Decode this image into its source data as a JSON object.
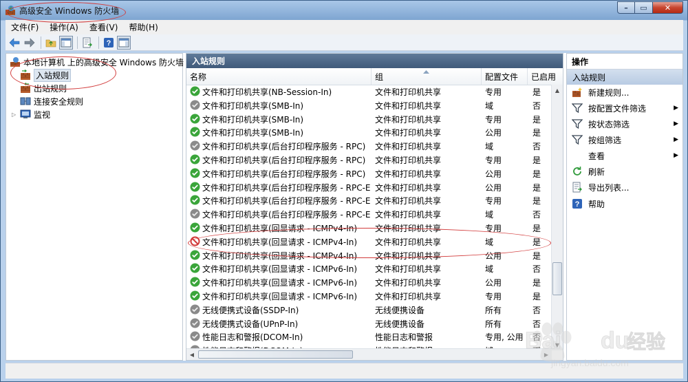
{
  "window": {
    "title": "高级安全 Windows 防火墙"
  },
  "controls": {
    "minimize": "–",
    "maximize": "▭",
    "close": "✕"
  },
  "menu": [
    {
      "label": "文件(F)"
    },
    {
      "label": "操作(A)"
    },
    {
      "label": "查看(V)"
    },
    {
      "label": "帮助(H)"
    }
  ],
  "tree": {
    "root": "本地计算机 上的高级安全 Windows 防火墙",
    "items": [
      {
        "label": "入站规则"
      },
      {
        "label": "出站规则"
      },
      {
        "label": "连接安全规则"
      },
      {
        "label": "监视"
      }
    ]
  },
  "rules_pane": {
    "title": "入站规则",
    "columns": [
      "名称",
      "组",
      "配置文件",
      "已启用"
    ],
    "rows": [
      {
        "status": "allow",
        "name": "文件和打印机共享(NB-Session-In)",
        "group": "文件和打印机共享",
        "profile": "专用",
        "enabled": "是"
      },
      {
        "status": "disabled",
        "name": "文件和打印机共享(SMB-In)",
        "group": "文件和打印机共享",
        "profile": "域",
        "enabled": "否"
      },
      {
        "status": "allow",
        "name": "文件和打印机共享(SMB-In)",
        "group": "文件和打印机共享",
        "profile": "专用",
        "enabled": "是"
      },
      {
        "status": "allow",
        "name": "文件和打印机共享(SMB-In)",
        "group": "文件和打印机共享",
        "profile": "公用",
        "enabled": "是"
      },
      {
        "status": "disabled",
        "name": "文件和打印机共享(后台打印程序服务 - RPC)",
        "group": "文件和打印机共享",
        "profile": "域",
        "enabled": "否"
      },
      {
        "status": "allow",
        "name": "文件和打印机共享(后台打印程序服务 - RPC)",
        "group": "文件和打印机共享",
        "profile": "专用",
        "enabled": "是"
      },
      {
        "status": "allow",
        "name": "文件和打印机共享(后台打印程序服务 - RPC)",
        "group": "文件和打印机共享",
        "profile": "公用",
        "enabled": "是"
      },
      {
        "status": "allow",
        "name": "文件和打印机共享(后台打印程序服务 - RPC-E...",
        "group": "文件和打印机共享",
        "profile": "公用",
        "enabled": "是"
      },
      {
        "status": "allow",
        "name": "文件和打印机共享(后台打印程序服务 - RPC-E...",
        "group": "文件和打印机共享",
        "profile": "专用",
        "enabled": "是"
      },
      {
        "status": "disabled",
        "name": "文件和打印机共享(后台打印程序服务 - RPC-E...",
        "group": "文件和打印机共享",
        "profile": "域",
        "enabled": "否"
      },
      {
        "status": "allow",
        "name": "文件和打印机共享(回显请求 - ICMPv4-In)",
        "group": "文件和打印机共享",
        "profile": "专用",
        "enabled": "是"
      },
      {
        "status": "block",
        "name": "文件和打印机共享(回显请求 - ICMPv4-In)",
        "group": "文件和打印机共享",
        "profile": "域",
        "enabled": "是"
      },
      {
        "status": "allow",
        "name": "文件和打印机共享(回显请求 - ICMPv4-In)",
        "group": "文件和打印机共享",
        "profile": "公用",
        "enabled": "是"
      },
      {
        "status": "allow",
        "name": "文件和打印机共享(回显请求 - ICMPv6-In)",
        "group": "文件和打印机共享",
        "profile": "域",
        "enabled": "否"
      },
      {
        "status": "allow",
        "name": "文件和打印机共享(回显请求 - ICMPv6-In)",
        "group": "文件和打印机共享",
        "profile": "公用",
        "enabled": "是"
      },
      {
        "status": "allow",
        "name": "文件和打印机共享(回显请求 - ICMPv6-In)",
        "group": "文件和打印机共享",
        "profile": "专用",
        "enabled": "是"
      },
      {
        "status": "disabled",
        "name": "无线便携式设备(SSDP-In)",
        "group": "无线便携设备",
        "profile": "所有",
        "enabled": "否"
      },
      {
        "status": "disabled",
        "name": "无线便携式设备(UPnP-In)",
        "group": "无线便携设备",
        "profile": "所有",
        "enabled": "否"
      },
      {
        "status": "disabled",
        "name": "性能日志和警报(DCOM-In)",
        "group": "性能日志和警报",
        "profile": "专用, 公用",
        "enabled": "否"
      },
      {
        "status": "disabled",
        "name": "性能日志和警报(DCOM-In)",
        "group": "性能日志和警报",
        "profile": "域",
        "enabled": "否"
      }
    ]
  },
  "actions": {
    "title": "操作",
    "section": "入站规则",
    "items": [
      {
        "icon": "new-rule-icon",
        "label": "新建规则...",
        "arrow": false
      },
      {
        "icon": "filter-icon",
        "label": "按配置文件筛选",
        "arrow": true
      },
      {
        "icon": "filter-icon",
        "label": "按状态筛选",
        "arrow": true
      },
      {
        "icon": "filter-icon",
        "label": "按组筛选",
        "arrow": true
      },
      {
        "icon": "none",
        "label": "查看",
        "arrow": true
      },
      {
        "icon": "refresh-icon",
        "label": "刷新",
        "arrow": false
      },
      {
        "icon": "export-icon",
        "label": "导出列表...",
        "arrow": false
      },
      {
        "icon": "help-icon",
        "label": "帮助",
        "arrow": false
      }
    ]
  },
  "watermark": {
    "brand": "Bai",
    "brand2": "du",
    "text": "经验",
    "url": "jingyan.baidu.com"
  },
  "colors": {
    "allow": "#3aa53a",
    "disabled": "#8a8a8a",
    "block": "#d23b3b",
    "annotation": "#d23b3b"
  }
}
